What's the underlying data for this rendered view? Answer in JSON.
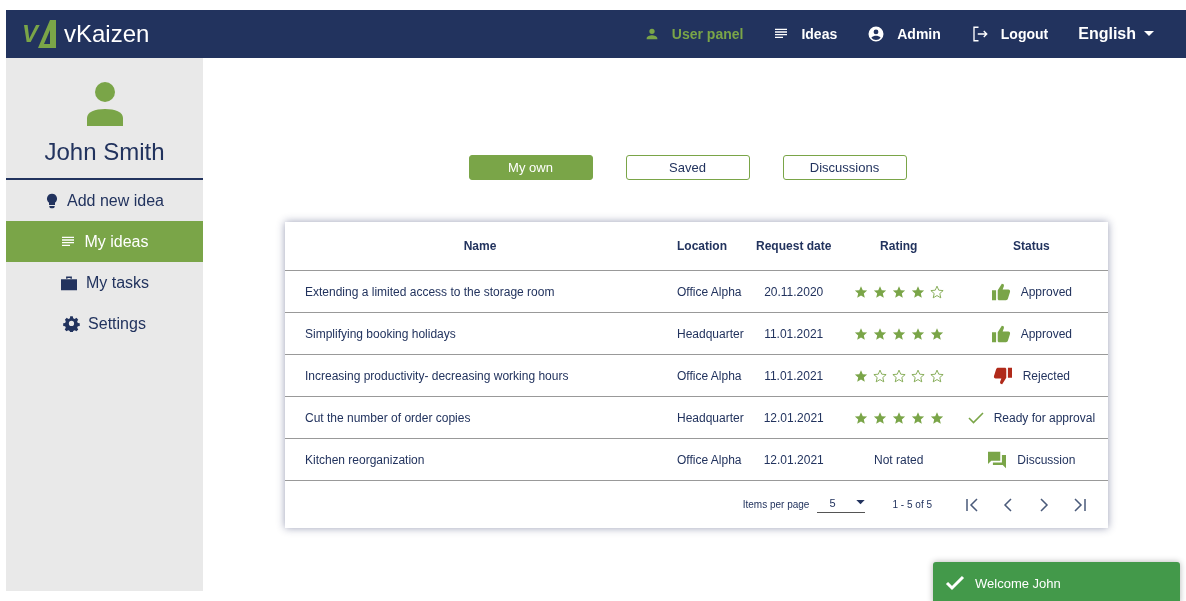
{
  "header": {
    "logo_mark": "V",
    "brand": "vKaizen",
    "nav": [
      {
        "label": "User panel",
        "kind": "user",
        "selected": true
      },
      {
        "label": "Ideas",
        "kind": "list",
        "selected": false
      },
      {
        "label": "Admin",
        "kind": "account",
        "selected": false
      },
      {
        "label": "Logout",
        "kind": "logout",
        "selected": false
      }
    ],
    "language": "English"
  },
  "sidebar": {
    "user_name": "John Smith",
    "items": [
      {
        "label": "Add new idea",
        "kind": "bulb",
        "selected": false
      },
      {
        "label": "My ideas",
        "kind": "list",
        "selected": true
      },
      {
        "label": "My tasks",
        "kind": "briefcase",
        "selected": false
      },
      {
        "label": "Settings",
        "kind": "gear",
        "selected": false
      }
    ]
  },
  "tabs": [
    {
      "label": "My own",
      "selected": true
    },
    {
      "label": "Saved",
      "selected": false
    },
    {
      "label": "Discussions",
      "selected": false
    }
  ],
  "table": {
    "columns": [
      "Name",
      "Location",
      "Request date",
      "Rating",
      "Status"
    ],
    "rows": [
      {
        "name": "Extending a limited access to the storage room",
        "location": "Office Alpha",
        "date": "20.11.2020",
        "stars": 4,
        "status": {
          "kind": "approved",
          "label": "Approved"
        }
      },
      {
        "name": "Simplifying booking holidays",
        "location": "Headquarter",
        "date": "11.01.2021",
        "stars": 5,
        "status": {
          "kind": "approved",
          "label": "Approved"
        }
      },
      {
        "name": "Increasing productivity- decreasing working hours",
        "location": "Office Alpha",
        "date": "11.01.2021",
        "stars": 1,
        "status": {
          "kind": "rejected",
          "label": "Rejected"
        }
      },
      {
        "name": "Cut the number of order copies",
        "location": "Headquarter",
        "date": "12.01.2021",
        "stars": 5,
        "status": {
          "kind": "ready",
          "label": "Ready for approval"
        }
      },
      {
        "name": "Kitchen reorganization",
        "location": "Office Alpha",
        "date": "12.01.2021",
        "rating_text": "Not rated",
        "status": {
          "kind": "discussion",
          "label": "Discussion"
        }
      }
    ],
    "paginator": {
      "items_per_page_label": "Items per page",
      "page_size": "5",
      "range": "1 - 5 of 5"
    }
  },
  "toast": {
    "message": "Welcome John"
  }
}
